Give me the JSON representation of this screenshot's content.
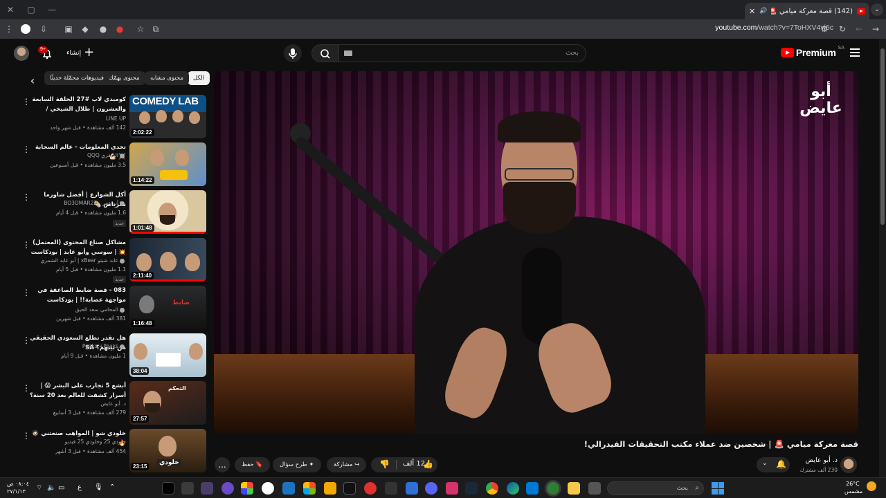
{
  "browser": {
    "tab_title": "(142) قصة معركة ميامي 🚨 | ...",
    "tab_close": "✕",
    "new_tab": "+",
    "url_host": "youtube.com",
    "url_path": "/watch?v=7ToHXV4vj6c",
    "window_controls": [
      "—",
      "▢",
      "✕"
    ]
  },
  "yt": {
    "brand": "Premium",
    "region": "SA",
    "search_placeholder": "بحث",
    "create_label": "إنشاء",
    "notif_badge": "9+"
  },
  "chips": [
    "الكل",
    "محتوى مشابه",
    "محتوى يهمّك",
    "فيديوهات محمّلة حديثًا"
  ],
  "videos": [
    {
      "title": "كوميدي لاب #27 الحلقة السابعة والعشرون | طلال الشيخي / بدران وضيوف الحلقة ابرا...",
      "channel": "LINE UP",
      "meta": "142 ألف مشاهدة • قبل شهر واحد",
      "duration": "2:02:22",
      "art": "COMEDY LAB",
      "new": ""
    },
    {
      "title": "تحدي المعلومات - عالم السحابة ⚔️ 💪🏻",
      "channel": "الشقري QQQ",
      "meta": "3.5 مليون مشاهدة • قبل أسبوعين",
      "duration": "1:14:22",
      "art": "",
      "new": ""
    },
    {
      "title": "أكل الشوارع | أفضل شاورما بالرياض 🌯",
      "channel": "أبو عمر - BO3OMAR22",
      "meta": "1.6 مليون مشاهدة • قبل 4 أيام",
      "duration": "1:01:48",
      "art": "",
      "new": "جديد"
    },
    {
      "title": "مشاكل صناع المحتوى (المعتمل) 💥 | سوسي وأبو عابد | بودكاست يسير خير",
      "channel": "عابد شيتو xBear | أبو عابد الشمري",
      "meta": "1.1 مليون مشاهدة • قبل 5 أيام",
      "duration": "2:11:40",
      "art": "",
      "new": "جديد"
    },
    {
      "title": "083 - قصة ضابط الصاعقة في مواجهة عصابة!! | بودكاست مثيرات قضائية",
      "channel": "المحامي سعد الحيق",
      "meta": "381 ألف مشاهدة • قبل شهرين",
      "duration": "1:16:48",
      "art": "",
      "new": ""
    },
    {
      "title": "هل تقدر تطلع السعودي الحقيقي من بينهم؟ SA",
      "channel": "Peaks +Peaks",
      "meta": "1 مليون مشاهدة • قبل 9 أيام",
      "duration": "38:04",
      "art": "",
      "new": ""
    },
    {
      "title": "أبشع 5 تجارب على البشر 😱 | أسرار كشفت للعالم بعد 20 سنة؟",
      "channel": "د. أبو عايض",
      "meta": "279 ألف مشاهدة • قبل 3 أسابيع",
      "duration": "27:57",
      "art": "",
      "new": ""
    },
    {
      "title": "خلودي شو | المواهب صنعتني 🧔🏻🔥",
      "channel": "خلودي 25 وخلودي 25 فيديو",
      "meta": "454 ألف مشاهدة • قبل 3 أشهر",
      "duration": "23:15",
      "art": "",
      "new": ""
    }
  ],
  "player": {
    "watermark": "أبو عايض"
  },
  "watch": {
    "title": "قصة معركة ميامي 🚨 | شخصين ضد عملاء مكتب التحقيقات الفيدرالي!",
    "owner": "د. أبو عايض",
    "subs": "230 ألف مشترك",
    "likes": "12 ألف",
    "share": "مشاركة",
    "ask": "طرح سؤال",
    "save": "حفظ",
    "more": "..."
  },
  "taskbar": {
    "search_placeholder": "بحث",
    "weather_temp": "26°C",
    "weather_desc": "مشمس",
    "time": "٠٨:٠٤ ص",
    "date": "٢٧/١/١٣",
    "lang": "ع"
  }
}
